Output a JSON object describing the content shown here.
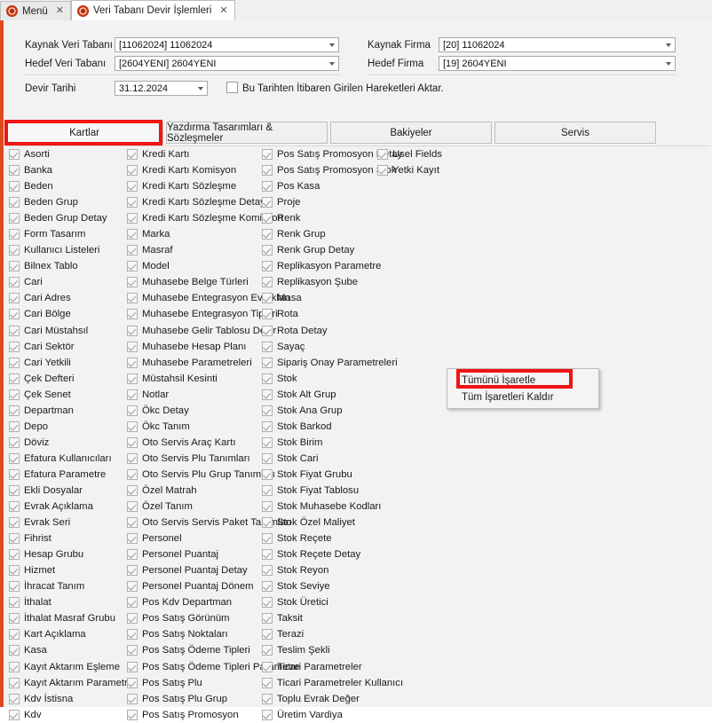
{
  "window_tabs": [
    {
      "label": "Menü",
      "icon": "app-gear-icon",
      "active": false
    },
    {
      "label": "Veri Tabanı Devir İşlemleri",
      "icon": "app-gear-icon",
      "active": true
    }
  ],
  "close_glyph": "✕",
  "form": {
    "kaynak_veri_tabani_label": "Kaynak Veri Tabanı",
    "kaynak_veri_tabani_value": "[11062024] 11062024",
    "hedef_veri_tabani_label": "Hedef Veri Tabanı",
    "hedef_veri_tabani_value": "[2604YENI] 2604YENI",
    "kaynak_firma_label": "Kaynak Firma",
    "kaynak_firma_value": "[20] 11062024",
    "hedef_firma_label": "Hedef Firma",
    "hedef_firma_value": "[19] 2604YENI",
    "devir_tarihi_label": "Devir Tarihi",
    "devir_tarihi_value": "31.12.2024",
    "aktar_checkbox_label": "Bu Tarihten İtibaren Girilen Hareketleri Aktar.",
    "aktar_checkbox_checked": false
  },
  "page_tabs": [
    {
      "label": "Kartlar",
      "selected": true,
      "highlighted": true
    },
    {
      "label": "Yazdırma Tasarımları & Sözleşmeler",
      "selected": false,
      "highlighted": false
    },
    {
      "label": "Bakiyeler",
      "selected": false,
      "highlighted": false
    },
    {
      "label": "Servis",
      "selected": false,
      "highlighted": false
    }
  ],
  "columns": [
    {
      "name": "column-1",
      "items": [
        "Asorti",
        "Banka",
        "Beden",
        "Beden Grup",
        "Beden Grup Detay",
        "Form Tasarım",
        "Kullanıcı Listeleri",
        "Bilnex Tablo",
        "Cari",
        "Cari Adres",
        "Cari Bölge",
        "Cari Müstahsıl",
        "Cari Sektör",
        "Cari Yetkili",
        "Çek Defteri",
        "Çek Senet",
        "Departman",
        "Depo",
        "Döviz",
        "Efatura Kullanıcıları",
        "Efatura Parametre",
        "Ekli Dosyalar",
        "Evrak Açıklama",
        "Evrak Seri",
        "Fihrist",
        "Hesap Grubu",
        "Hizmet",
        "İhracat Tanım",
        "İthalat",
        "İthalat Masraf Grubu",
        "Kart Açıklama",
        "Kasa",
        "Kayıt Aktarım Eşleme",
        "Kayıt Aktarım Parametre",
        "Kdv İstisna",
        "Kdv"
      ]
    },
    {
      "name": "column-2",
      "items": [
        "Kredi Kartı",
        "Kredi Kartı Komisyon",
        "Kredi Kartı Sözleşme",
        "Kredi Kartı Sözleşme Detay",
        "Kredi Kartı Sözleşme Komisyon",
        "Marka",
        "Masraf",
        "Model",
        "Muhasebe Belge Türleri",
        "Muhasebe Entegrasyon Evrakları",
        "Muhasebe Entegrasyon Tipleri",
        "Muhasebe Gelir Tablosu Devir",
        "Muhasebe Hesap Planı",
        "Muhasebe Parametreleri",
        "Müstahsil Kesinti",
        "Notlar",
        "Ökc Detay",
        "Ökc Tanım",
        "Oto Servis Araç Kartı",
        "Oto Servis Plu Tanımları",
        "Oto Servis Plu Grup Tanımları",
        "Özel Matrah",
        "Özel Tanım",
        "Oto Servis Servis Paket Tanımları",
        "Personel",
        "Personel Puantaj",
        "Personel Puantaj Detay",
        "Personel Puantaj Dönem",
        "Pos Kdv Departman",
        "Pos Satış Görünüm",
        "Pos Satış Noktaları",
        "Pos Satış Ödeme Tipleri",
        "Pos Satış Ödeme Tipleri Parametre",
        "Pos Satış Plu",
        "Pos Satış Plu Grup",
        "Pos Satış Promosyon"
      ]
    },
    {
      "name": "column-3",
      "items": [
        "Pos Satış Promosyon Detay",
        "Pos Satış Promosyon Stok",
        "Pos Kasa",
        "Proje",
        "Renk",
        "Renk Grup",
        "Renk Grup Detay",
        "Replikasyon Parametre",
        "Replikasyon Şube",
        "Masa",
        "Rota",
        "Rota Detay",
        "Sayaç",
        "Sipariş Onay Parametreleri",
        "Stok",
        "Stok Alt Grup",
        "Stok Ana Grup",
        "Stok Barkod",
        "Stok Birim",
        "Stok Cari",
        "Stok Fiyat Grubu",
        "Stok Fiyat Tablosu",
        "Stok Muhasebe Kodları",
        "Stok Özel Maliyet",
        "Stok Reçete",
        "Stok Reçete Detay",
        "Stok Reyon",
        "Stok Seviye",
        "Stok Üretici",
        "Taksit",
        "Terazi",
        "Teslim Şekli",
        "Ticari Parametreler",
        "Ticari Parametreler Kullanıcı",
        "Toplu Evrak Değer",
        "Üretim Vardiya"
      ]
    },
    {
      "name": "column-4",
      "items": [
        "Usel Fields",
        "Yetki Kayıt"
      ]
    }
  ],
  "context_menu": {
    "items": [
      {
        "label": "Tümünü İşaretle",
        "highlighted": true
      },
      {
        "label": "Tüm İşaretleri Kaldır",
        "highlighted": false
      }
    ]
  },
  "colors": {
    "highlight_red": "#f01414",
    "window_accent": "#e04a1a",
    "panel_bg": "#f2f2f2",
    "tab_bg": "#f0f0f0"
  }
}
